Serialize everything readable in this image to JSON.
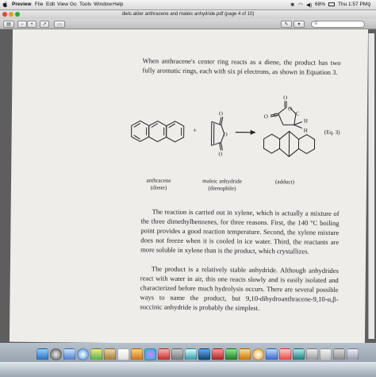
{
  "menubar": {
    "app": "Preview",
    "items": [
      "File",
      "Edit",
      "View",
      "Go",
      "Tools",
      "Window",
      "Help"
    ],
    "battery": "68%",
    "clock": "Thu 1:57 PM"
  },
  "window": {
    "title": "diels alder anthracene and maleic anhydride.pdf (page 4 of 10)"
  },
  "document": {
    "intro": "When anthracene's center ring reacts as a diene, the product has two fully aromatic rings, each with six pi electrons, as shown in Equation 3.",
    "equation_label": "(Eq. 3)",
    "plus": "+",
    "labels": {
      "anthracene": "anthracene",
      "anthracene_role": "(diene)",
      "maleic": "maleic anhydride",
      "maleic_role": "(dienophile)",
      "adduct": "(adduct)"
    },
    "atoms": {
      "O": "O",
      "C": "C",
      "H": "H"
    },
    "para2": "The reaction is carried out in xylene, which is actually a mixture of the three dimethylbenzenes, for three reasons. First, the 140 °C boiling point provides a good reaction temperature. Second, the xylene mixture does not freeze when it is cooled in ice water. Third, the reactants are more soluble in xylene than is the product, which crystallizes.",
    "para3": "The product is a relatively stable anhydride. Although anhydrides react with water in air, this one reacts slowly and is easily isolated and characterized before much hydrolysis occurs. There are several possible ways to name the product, but 9,10-dihydroanthracene-9,10-α,β-succinic anhydride is probably the simplest."
  }
}
